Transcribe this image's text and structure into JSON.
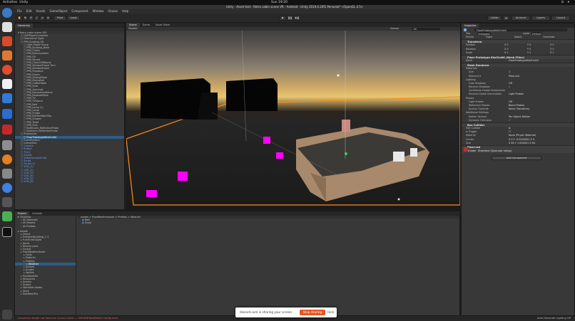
{
  "os": {
    "activities": "Activities",
    "app_name": "Unity",
    "clock": "Sun 19:20",
    "tray": "⏻ ▾"
  },
  "window": {
    "title": "Unity - Asset test - Retro cabin scene VR - Android - Unity 2019.4.20f1 Personal* <OpenGL 4.5>"
  },
  "menu": [
    "File",
    "Edit",
    "Assets",
    "GameObject",
    "Component",
    "Window",
    "Oculus",
    "Help"
  ],
  "toolbar": {
    "pivot": "Pivot",
    "local": "Local",
    "account": "Account",
    "layers": "Layers",
    "layout": "Layout",
    "collab": "Collab"
  },
  "hierarchy": {
    "tab": "Hierarchy",
    "scene_name": "Retro cabin scene VR*",
    "items": [
      {
        "text": "OVRPlayerController",
        "indent": 2,
        "cls": ""
      },
      {
        "text": "Directional Light",
        "indent": 2,
        "cls": ""
      },
      {
        "text": "PPB_Building_Kit",
        "indent": 2,
        "cls": ""
      },
      {
        "text": "Light Probe Group",
        "indent": 3,
        "cls": ""
      },
      {
        "text": "PPB_Building_Base",
        "indent": 3,
        "cls": ""
      },
      {
        "text": "PPB_Chairs",
        "indent": 3,
        "cls": ""
      },
      {
        "text": "PPB_Balconystairs",
        "indent": 3,
        "cls": ""
      },
      {
        "text": "PPB_Fill",
        "indent": 3,
        "cls": ""
      },
      {
        "text": "PPB_Panels",
        "indent": 3,
        "cls": ""
      },
      {
        "text": "PPB_CheckOffStores",
        "indent": 3,
        "cls": ""
      },
      {
        "text": "PPB_WindowFrame Trim",
        "indent": 3,
        "cls": ""
      },
      {
        "text": "PPB_WindowFrame",
        "indent": 3,
        "cls": ""
      },
      {
        "text": "PPB_Fireplace",
        "indent": 3,
        "cls": ""
      },
      {
        "text": "PPB_Floors",
        "indent": 3,
        "cls": ""
      },
      {
        "text": "PPB_SlidingPlane",
        "indent": 3,
        "cls": ""
      },
      {
        "text": "PPB_DiningSet",
        "indent": 3,
        "cls": ""
      },
      {
        "text": "PPB_CoffeeTable",
        "indent": 3,
        "cls": ""
      },
      {
        "text": "PPB_Sofa",
        "indent": 3,
        "cls": ""
      },
      {
        "text": "PPB_Armchair",
        "indent": 3,
        "cls": ""
      },
      {
        "text": "PPB_DecorationItems",
        "indent": 3,
        "cls": ""
      },
      {
        "text": "PPB_BedsideTable",
        "indent": 3,
        "cls": ""
      },
      {
        "text": "PPB_TV",
        "indent": 3,
        "cls": ""
      },
      {
        "text": "PPB_TVStand",
        "indent": 3,
        "cls": ""
      },
      {
        "text": "PPB_Bed",
        "indent": 3,
        "cls": ""
      },
      {
        "text": "PPB_Lamp (1)",
        "indent": 3,
        "cls": ""
      },
      {
        "text": "PPB_Lamp",
        "indent": 3,
        "cls": ""
      },
      {
        "text": "PPB_Fridge",
        "indent": 3,
        "cls": ""
      },
      {
        "text": "PPB_KitchenWorkTop",
        "indent": 3,
        "cls": ""
      },
      {
        "text": "PPB_Shower",
        "indent": 3,
        "cls": ""
      },
      {
        "text": "PPB_Toilet",
        "indent": 3,
        "cls": ""
      },
      {
        "text": "PPB_Sink",
        "indent": 3,
        "cls": ""
      },
      {
        "text": "Bathroom_ReflectionProbe",
        "indent": 3,
        "cls": ""
      },
      {
        "text": "Bedroom_ReflectionProbe",
        "indent": 3,
        "cls": ""
      },
      {
        "text": "Prototypes",
        "indent": 2,
        "cls": ""
      },
      {
        "text": "FloorPrototype64x01x64",
        "indent": 3,
        "cls": "sel"
      },
      {
        "text": "EventSystem",
        "indent": 2,
        "cls": ""
      },
      {
        "text": "Interaction",
        "indent": 2,
        "cls": ""
      },
      {
        "text": "Camera",
        "indent": 2,
        "cls": "blue"
      },
      {
        "text": "Button",
        "indent": 2,
        "cls": "blue"
      },
      {
        "text": "TV(1)",
        "indent": 2,
        "cls": "blue"
      },
      {
        "text": "Sound",
        "indent": 2,
        "cls": "blue"
      },
      {
        "text": "VideoCanvasScript",
        "indent": 2,
        "cls": "blue"
      },
      {
        "text": "Script",
        "indent": 2,
        "cls": "blue"
      },
      {
        "text": "Script (1)",
        "indent": 2,
        "cls": "blue"
      },
      {
        "text": "VCR_(1)",
        "indent": 2,
        "cls": "blue"
      },
      {
        "text": "VCR_(2)",
        "indent": 2,
        "cls": "blue"
      },
      {
        "text": "VCR_(3)",
        "indent": 2,
        "cls": "blue"
      },
      {
        "text": "VCR_(4)",
        "indent": 2,
        "cls": "blue"
      },
      {
        "text": "VCR_(5)",
        "indent": 2,
        "cls": "blue"
      },
      {
        "text": "VCR_(6)",
        "indent": 2,
        "cls": "blue"
      }
    ]
  },
  "scene_tabs": {
    "scene": "Scene",
    "game": "Game",
    "asset_store": "Asset Store",
    "shading": "Shaded",
    "gizmos": "Gizmos",
    "search": "All"
  },
  "inspector": {
    "tab": "Inspector",
    "object_name": "FloorPrototype64x01x64",
    "tag_label": "Tag",
    "tag_value": "Untagged",
    "layer_label": "Layer",
    "layer_value": "Default",
    "prefab_label": "Prefab",
    "prefab_open": "Open",
    "prefab_select": "Select",
    "prefab_overrides": "Overrides",
    "transform": {
      "title": "Transform",
      "position_label": "Position",
      "position": [
        "X 0",
        "Y 0",
        "Z 0"
      ],
      "rotation_label": "Rotation",
      "rotation": [
        "X 0",
        "Y 0",
        "Z 0"
      ],
      "scale_label": "Scale",
      "scale": [
        "X 1",
        "Y 1",
        "Z 1"
      ]
    },
    "mesh_filter": {
      "title": "Floor Prototype 64x01x64 (Mesh Filter)",
      "mesh_label": "Mesh",
      "mesh_value": "FloorPrototype64x01x64"
    },
    "mesh_renderer": {
      "title": "Mesh Renderer",
      "materials_label": "Materials",
      "size_label": "Size",
      "size_value": "1",
      "element_label": "Element 0",
      "element_value": "Plexi-red",
      "lighting_label": "Lighting",
      "cast_shadows_label": "Cast Shadows",
      "cast_shadows_value": "Off",
      "receive_shadows_label": "Receive Shadows",
      "contribute_gi_label": "Contribute Global Illumination",
      "receive_gi_label": "Receive Global Illumination",
      "receive_gi_value": "Light Probes",
      "probes_label": "Probes",
      "light_probes_label": "Light Probes",
      "light_probes_value": "Off",
      "reflection_label": "Reflection Probes",
      "reflection_value": "Blend Probes",
      "anchor_label": "Anchor Override",
      "anchor_value": "None (Transform)",
      "additional_label": "Additional Settings",
      "motion_label": "Motion Vectors",
      "motion_value": "Per Object Motion",
      "dynamic_label": "Dynamic Occlusion"
    },
    "box_collider": {
      "title": "Box Collider",
      "edit_label": "Edit Collider",
      "trigger_label": "Is Trigger",
      "material_label": "Material",
      "material_value": "None (Physic Material)",
      "center_label": "Center",
      "center_value": "X 0   Y -0.5000002   Z 0",
      "size_label": "Size",
      "size_value": "X 64   Y 1.000001   Z 64"
    },
    "material": {
      "name": "Plexi-red",
      "shader_label": "Shader",
      "shader_value": "Standard (Specular setup)"
    },
    "add_component": "Add Component"
  },
  "project": {
    "tab_project": "Project",
    "tab_console": "Console",
    "favorites": "Favorites",
    "fav_items": [
      "All Materials",
      "All Models",
      "All Prefabs"
    ],
    "assets_root": "Assets",
    "tree": [
      {
        "text": "Assets",
        "indent": 1
      },
      {
        "text": "Chord",
        "indent": 2
      },
      {
        "text": "FreeStartBuilding_1.3",
        "indent": 2
      },
      {
        "text": "FurnitureOLight",
        "indent": 2
      },
      {
        "text": "Items",
        "indent": 2
      },
      {
        "text": "Kenney pack",
        "indent": 2
      },
      {
        "text": "Oculus",
        "indent": 2
      },
      {
        "text": "PixelWeatherAsset",
        "indent": 2
      },
      {
        "text": "Fonts",
        "indent": 3
      },
      {
        "text": "Material",
        "indent": 3
      },
      {
        "text": "Prefabs",
        "indent": 3
      },
      {
        "text": "Weather",
        "indent": 4,
        "sel": true
      },
      {
        "text": "Scenes",
        "indent": 3
      },
      {
        "text": "Scripts",
        "indent": 3
      },
      {
        "text": "Sprites",
        "indent": 3
      },
      {
        "text": "PolyWorldKit",
        "indent": 2
      },
      {
        "text": "Resources",
        "indent": 2
      },
      {
        "text": "Scenes",
        "indent": 2
      },
      {
        "text": "Scripts",
        "indent": 2
      },
      {
        "text": "Standard Assets",
        "indent": 2
      },
      {
        "text": "Store",
        "indent": 2
      },
      {
        "text": "TextMeshPro",
        "indent": 2
      }
    ],
    "breadcrumb": "Assets > PixelWeatherAsset > Prefabs > Weather",
    "files": [
      "Rain",
      "Snow"
    ]
  },
  "share": {
    "message": "discord.com is sharing your screen.",
    "stop": "Stop sharing",
    "hide": "Hide"
  },
  "status": {
    "error": "Connection target not found on Oculus Quest — OVRADBTool/Mobile Config error",
    "right": "Auto Generate Lighting Off"
  },
  "colors": {
    "accent_orange": "#ff8a1e",
    "selection_blue": "#2c5d87",
    "magenta_marker": "#ff00ff",
    "stop_button": "#e95420"
  }
}
